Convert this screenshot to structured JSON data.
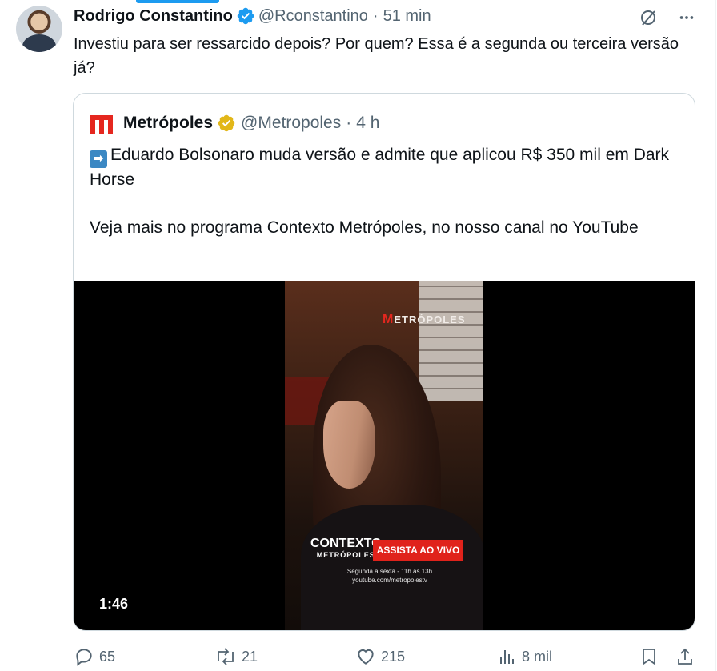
{
  "tweet": {
    "author_name": "Rodrigo Constantino",
    "handle": "@Rconstantino",
    "separator": "·",
    "time": "51 min",
    "text": "Investiu para ser ressarcido depois? Por quem? Essa é a segunda ou terceira versão já?"
  },
  "quote": {
    "author_name": "Metrópoles",
    "handle": "@Metropoles",
    "separator": "·",
    "time": "4 h",
    "arrow_emoji": "➡",
    "text": "Eduardo Bolsonaro muda versão e admite que aplicou R$ 350 mil em Dark Horse\n\nVeja mais no programa Contexto Metrópoles, no nosso canal no YouTube",
    "video": {
      "duration": "1:46",
      "overlay_brand_m": "M",
      "overlay_brand": "ETRÓPOLES",
      "program_title": "CONTEXTO",
      "program_sub": "METRÓPOLES",
      "live_button": "ASSISTA AO VIVO",
      "schedule_line1": "Segunda a sexta - 11h às 13h",
      "schedule_line2": "youtube.com/metropolestv"
    }
  },
  "actions": {
    "replies": "65",
    "reposts": "21",
    "likes": "215",
    "views": "8 mil"
  },
  "colors": {
    "accent": "#1d9bf0",
    "muted": "#536471",
    "gold_badge": "#e2b719",
    "brand_red": "#e5271f"
  }
}
